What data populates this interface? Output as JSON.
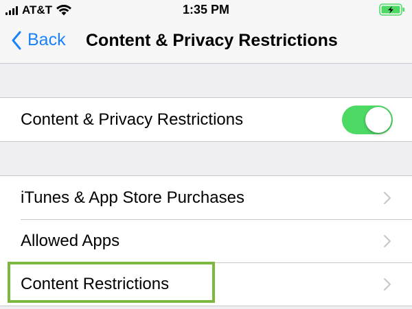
{
  "status_bar": {
    "carrier": "AT&T",
    "time": "1:35 PM",
    "battery_icon": "battery-charging-icon",
    "wifi_icon": "wifi-icon",
    "signal_icon": "cellular-signal-icon"
  },
  "nav": {
    "back_label": "Back",
    "title": "Content & Privacy Restrictions"
  },
  "toggle_group": {
    "label": "Content & Privacy Restrictions",
    "toggle_on": true
  },
  "settings_list": {
    "items": [
      {
        "label": "iTunes & App Store Purchases"
      },
      {
        "label": "Allowed Apps"
      },
      {
        "label": "Content Restrictions"
      }
    ]
  },
  "colors": {
    "accent": "#1a82fb",
    "toggle_on": "#4cd964",
    "highlight": "#7cb83e",
    "battery": "#4cd964",
    "background": "#efeff4"
  }
}
